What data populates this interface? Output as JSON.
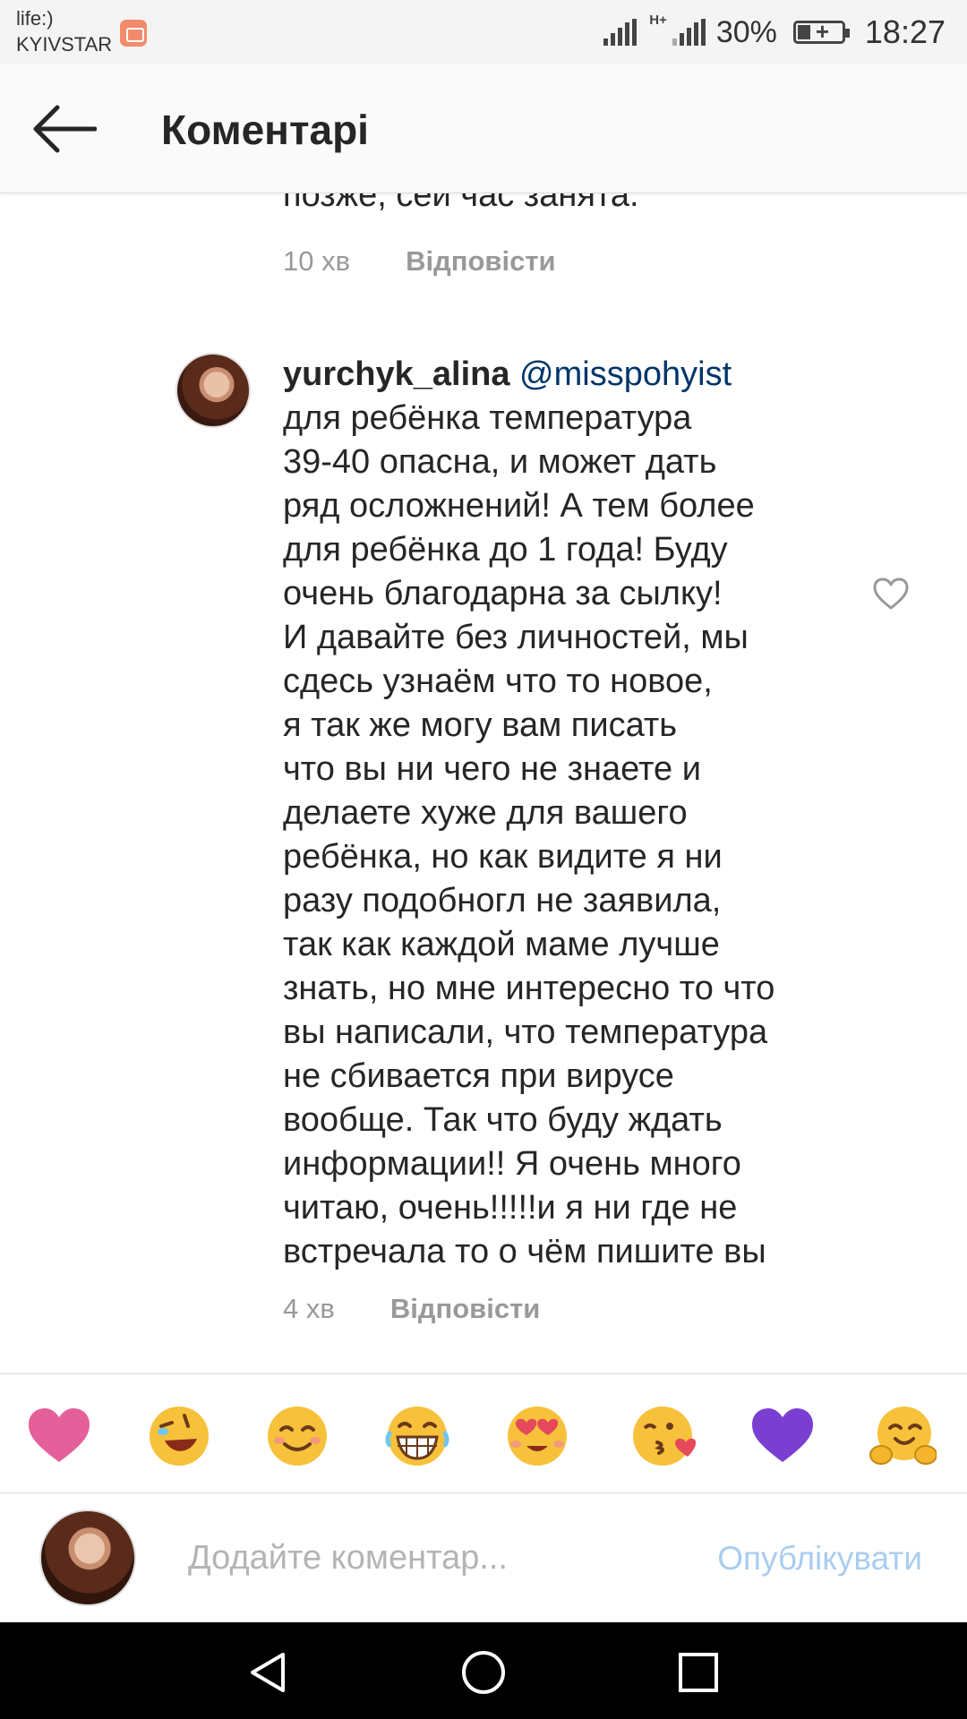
{
  "status_bar": {
    "carrier_line1": "life:)",
    "carrier_line2": "KYIVSTAR",
    "network_type": "H+",
    "battery_percent": "30%",
    "time": "18:27"
  },
  "header": {
    "title": "Коментарі"
  },
  "previous_comment": {
    "text_tail": "позже, сей час занята.",
    "time_ago": "10 хв",
    "reply_label": "Відповісти"
  },
  "comment": {
    "username": "yurchyk_alina",
    "mention": "@misspohyist",
    "lines": [
      "для ребёнка температура",
      "39-40 опасна, и может дать",
      "ряд осложнений! А тем более",
      "для ребёнка до 1 года! Буду",
      "очень благодарна за сылку!",
      "И давайте без личностей, мы",
      "сдесь узнаём что то новое,",
      "я так же могу вам писать",
      "что вы ни чего не знаете и",
      "делаете хуже для вашего",
      "ребёнка, но как видите я ни",
      "разу подобногл не заявила,",
      "так как каждой маме лучше",
      "знать, но мне интересно то что",
      "вы написали, что температура",
      "не сбивается при вирусе",
      "вообще. Так что буду ждать",
      "информации!! Я очень много",
      "читаю, очень!!!!!и я ни где не",
      "встречала то о чём пишите вы"
    ],
    "time_ago": "4 хв",
    "reply_label": "Відповісти"
  },
  "emoji_bar": [
    "heart-pink",
    "rolling-laughing",
    "smiling-blush",
    "grinning-tears",
    "heart-eyes",
    "kissing-heart",
    "heart-purple",
    "hugging"
  ],
  "composer": {
    "placeholder": "Додайте коментар...",
    "publish_label": "Опублікувати"
  },
  "colors": {
    "mention": "#003569",
    "publish_disabled": "#a9cdf1",
    "secondary_text": "#999999"
  }
}
